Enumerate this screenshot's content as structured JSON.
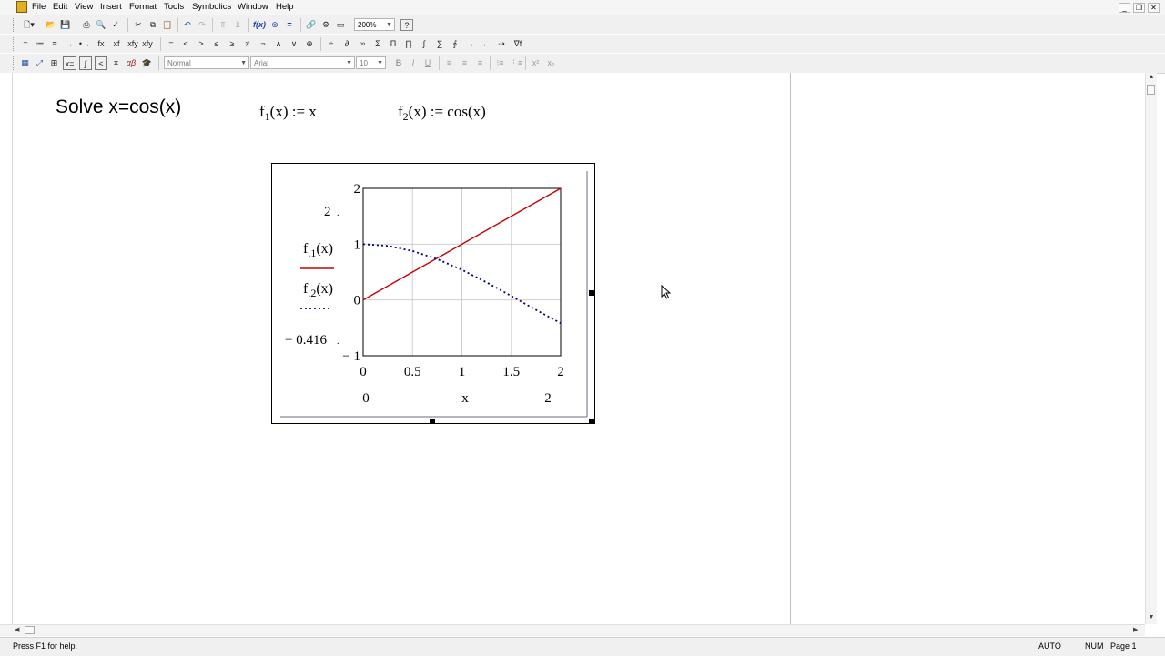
{
  "menubar": {
    "items": [
      "File",
      "Edit",
      "View",
      "Insert",
      "Format",
      "Tools",
      "Symbolics",
      "Window",
      "Help"
    ]
  },
  "window_controls": [
    "minimize-icon",
    "restore-icon",
    "close-icon"
  ],
  "toolbar": {
    "zoom": "200%",
    "style": "Normal",
    "font": "Arial",
    "size": "10",
    "bold": "B",
    "italic": "I",
    "underline": "U",
    "math_ops": [
      "=",
      "≔",
      "≡",
      "→",
      "•→",
      "fx",
      "xf",
      "xfy",
      "xfy"
    ],
    "bool_ops": [
      "=",
      "<",
      ">",
      "≤",
      "≥",
      "≠",
      "¬",
      "∧",
      "∨",
      "⊕"
    ]
  },
  "document": {
    "heading": "Solve x=cos(x)",
    "def1": {
      "name": "f",
      "sub": "1",
      "rest": "(x) := x"
    },
    "def2": {
      "name": "f",
      "sub": "2",
      "rest": "(x) := cos(x)"
    }
  },
  "chart_data": {
    "type": "line",
    "xlabel": "x",
    "xlim": [
      0,
      2
    ],
    "ylim": [
      -1,
      2
    ],
    "x_ticks": [
      "0",
      "0.5",
      "1",
      "1.5",
      "2"
    ],
    "y_ticks": [
      "2",
      "1",
      "0",
      "− 1"
    ],
    "x_range_labels": [
      "0",
      "2"
    ],
    "y_range_labels": [
      "2",
      "− 0.416"
    ],
    "grid": true,
    "series": [
      {
        "name": "f1(x)",
        "fn": "x",
        "color": "#cc0000",
        "style": "solid",
        "x": [
          0,
          0.5,
          1,
          1.5,
          2
        ],
        "y": [
          0,
          0.5,
          1,
          1.5,
          2
        ]
      },
      {
        "name": "f2(x)",
        "fn": "cos(x)",
        "color": "#000080",
        "style": "dotted",
        "x": [
          0,
          0.25,
          0.5,
          0.75,
          1,
          1.25,
          1.5,
          1.75,
          2
        ],
        "y": [
          1,
          0.969,
          0.878,
          0.732,
          0.54,
          0.315,
          0.071,
          -0.178,
          -0.416
        ]
      }
    ]
  },
  "statusbar": {
    "help": "Press F1 for help.",
    "auto": "AUTO",
    "num": "NUM",
    "page": "Page 1"
  }
}
